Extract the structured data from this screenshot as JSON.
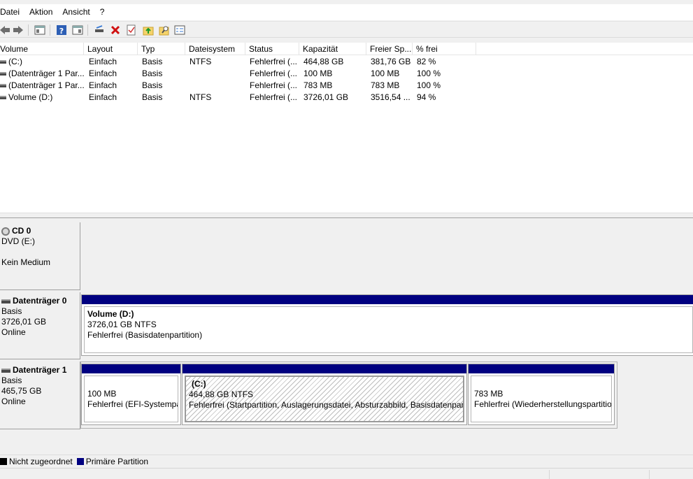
{
  "menu": [
    "Datei",
    "Aktion",
    "Ansicht",
    "?"
  ],
  "toolbar": {
    "buttons": [
      "back-arrow-icon",
      "forward-arrow-icon",
      "console-tree-icon",
      "help-icon",
      "properties-view-icon",
      "disk-connect-icon",
      "delete-icon",
      "check-icon",
      "folder-up-icon",
      "search-folder-icon",
      "list-properties-icon"
    ]
  },
  "columns": [
    "Volume",
    "Layout",
    "Typ",
    "Dateisystem",
    "Status",
    "Kapazität",
    "Freier Sp...",
    "% frei"
  ],
  "volumes": [
    {
      "volume": "(C:)",
      "layout": "Einfach",
      "typ": "Basis",
      "fs": "NTFS",
      "status": "Fehlerfrei (...",
      "kapazitaet": "464,88 GB",
      "frei": "381,76 GB",
      "prozent": "82 %"
    },
    {
      "volume": "(Datenträger 1 Par...",
      "layout": "Einfach",
      "typ": "Basis",
      "fs": "",
      "status": "Fehlerfrei (...",
      "kapazitaet": "100 MB",
      "frei": "100 MB",
      "prozent": "100 %"
    },
    {
      "volume": "(Datenträger 1 Par...",
      "layout": "Einfach",
      "typ": "Basis",
      "fs": "",
      "status": "Fehlerfrei (...",
      "kapazitaet": "783 MB",
      "frei": "783 MB",
      "prozent": "100 %"
    },
    {
      "volume": "Volume (D:)",
      "layout": "Einfach",
      "typ": "Basis",
      "fs": "NTFS",
      "status": "Fehlerfrei (...",
      "kapazitaet": "3726,01 GB",
      "frei": "3516,54 ...",
      "prozent": "94 %"
    }
  ],
  "disks": {
    "cd0": {
      "name": "CD 0",
      "type": "DVD (E:)",
      "media": "Kein Medium"
    },
    "disk0": {
      "name": "Datenträger 0",
      "type": "Basis",
      "size": "3726,01 GB",
      "state": "Online",
      "partitions": [
        {
          "title": "Volume  (D:)",
          "size": "3726,01 GB NTFS",
          "status": "Fehlerfrei (Basisdatenpartition)"
        }
      ]
    },
    "disk1": {
      "name": "Datenträger 1",
      "type": "Basis",
      "size": "465,75 GB",
      "state": "Online",
      "partitions": [
        {
          "title": "",
          "size": "100 MB",
          "status": "Fehlerfrei (EFI-Systempartition)"
        },
        {
          "title": "(C:)",
          "size": "464,88 GB NTFS",
          "status": "Fehlerfrei (Startpartition, Auslagerungsdatei, Absturzabbild, Basisdatenpartition)"
        },
        {
          "title": "",
          "size": "783 MB",
          "status": "Fehlerfrei (Wiederherstellungspartition)"
        }
      ]
    }
  },
  "legend": [
    {
      "label": "Nicht zugeordnet",
      "color": "#000000"
    },
    {
      "label": "Primäre Partition",
      "color": "#000080"
    }
  ]
}
